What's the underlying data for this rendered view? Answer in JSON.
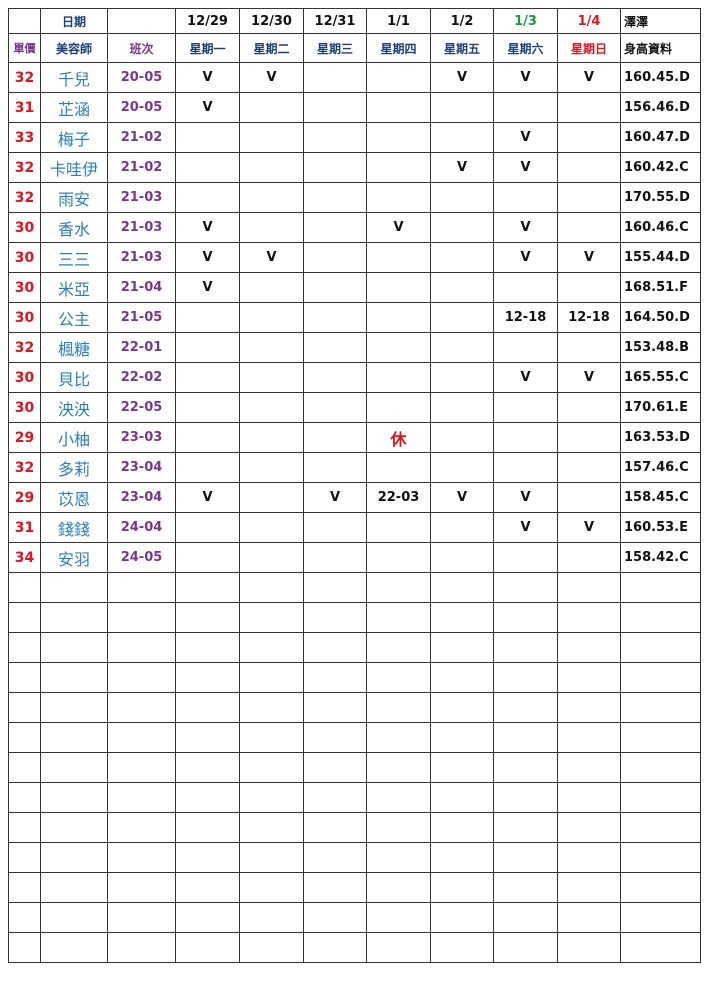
{
  "colors": {
    "price": "#e0141e",
    "name": "#2c7fbf",
    "shift": "#7a3494",
    "saturday": "#1a9c3e",
    "sunday": "#e0141e",
    "weekday_label": "#1a3f7a"
  },
  "header": {
    "date_label": "日期",
    "dates": [
      "12/29",
      "12/30",
      "12/31",
      "1/1",
      "1/2",
      "1/3",
      "1/4"
    ],
    "corner_title": "澤澤",
    "price_label": "單價",
    "name_label": "美容師",
    "shift_label": "班次",
    "weekdays": [
      "星期一",
      "星期二",
      "星期三",
      "星期四",
      "星期五",
      "星期六",
      "星期日"
    ],
    "height_label": "身高資料"
  },
  "rows": [
    {
      "price": "32",
      "name": "千兒",
      "shift": "20-05",
      "days": [
        "V",
        "V",
        "",
        "",
        "V",
        "V",
        "V"
      ],
      "height": "160.45.D"
    },
    {
      "price": "31",
      "name": "芷涵",
      "shift": "20-05",
      "days": [
        "V",
        "",
        "",
        "",
        "",
        "",
        ""
      ],
      "height": "156.46.D"
    },
    {
      "price": "33",
      "name": "梅子",
      "shift": "21-02",
      "days": [
        "",
        "",
        "",
        "",
        "",
        "V",
        ""
      ],
      "height": "160.47.D"
    },
    {
      "price": "32",
      "name": "卡哇伊",
      "shift": "21-02",
      "days": [
        "",
        "",
        "",
        "",
        "V",
        "V",
        ""
      ],
      "height": "160.42.C"
    },
    {
      "price": "32",
      "name": "雨安",
      "shift": "21-03",
      "days": [
        "",
        "",
        "",
        "",
        "",
        "",
        ""
      ],
      "height": "170.55.D"
    },
    {
      "price": "30",
      "name": "香水",
      "shift": "21-03",
      "days": [
        "V",
        "",
        "",
        "V",
        "",
        "V",
        ""
      ],
      "height": "160.46.C"
    },
    {
      "price": "30",
      "name": "三三",
      "shift": "21-03",
      "days": [
        "V",
        "V",
        "",
        "",
        "",
        "V",
        "V"
      ],
      "height": "155.44.D"
    },
    {
      "price": "30",
      "name": "米亞",
      "shift": "21-04",
      "days": [
        "V",
        "",
        "",
        "",
        "",
        "",
        ""
      ],
      "height": "168.51.F"
    },
    {
      "price": "30",
      "name": "公主",
      "shift": "21-05",
      "days": [
        "",
        "",
        "",
        "",
        "",
        "12-18",
        "12-18"
      ],
      "height": "164.50.D"
    },
    {
      "price": "32",
      "name": "楓糖",
      "shift": "22-01",
      "days": [
        "",
        "",
        "",
        "",
        "",
        "",
        ""
      ],
      "height": "153.48.B"
    },
    {
      "price": "30",
      "name": "貝比",
      "shift": "22-02",
      "days": [
        "",
        "",
        "",
        "",
        "",
        "V",
        "V"
      ],
      "height": "165.55.C"
    },
    {
      "price": "30",
      "name": "泱泱",
      "shift": "22-05",
      "days": [
        "",
        "",
        "",
        "",
        "",
        "",
        ""
      ],
      "height": "170.61.E"
    },
    {
      "price": "29",
      "name": "小柚",
      "shift": "23-03",
      "days": [
        "",
        "",
        "",
        "休",
        "",
        "",
        ""
      ],
      "height": "163.53.D"
    },
    {
      "price": "32",
      "name": "多莉",
      "shift": "23-04",
      "days": [
        "",
        "",
        "",
        "",
        "",
        "",
        ""
      ],
      "height": "157.46.C"
    },
    {
      "price": "29",
      "name": "苡恩",
      "shift": "23-04",
      "days": [
        "V",
        "",
        "V",
        "22-03",
        "V",
        "V",
        ""
      ],
      "height": "158.45.C"
    },
    {
      "price": "31",
      "name": "錢錢",
      "shift": "24-04",
      "days": [
        "",
        "",
        "",
        "",
        "",
        "V",
        "V"
      ],
      "height": "160.53.E"
    },
    {
      "price": "34",
      "name": "安羽",
      "shift": "24-05",
      "days": [
        "",
        "",
        "",
        "",
        "",
        "",
        ""
      ],
      "height": "158.42.C"
    }
  ]
}
